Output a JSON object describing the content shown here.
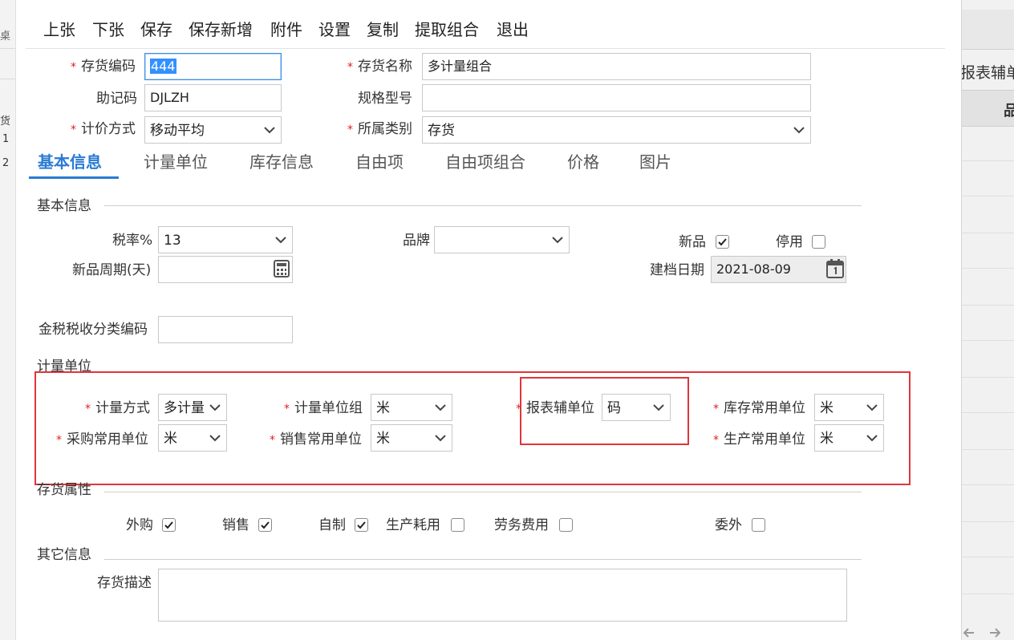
{
  "toolbar": {
    "prev": "上张",
    "next": "下张",
    "save": "保存",
    "save_new": "保存新增",
    "attach": "附件",
    "settings": "设置",
    "copy": "复制",
    "extract": "提取组合",
    "exit": "退出"
  },
  "header": {
    "code_label": "存货编码",
    "code_value": "444",
    "name_label": "存货名称",
    "name_value": "多计量组合",
    "mnemonic_label": "助记码",
    "mnemonic_value": "DJLZH",
    "spec_label": "规格型号",
    "spec_value": "",
    "pricing_label": "计价方式",
    "pricing_value": "移动平均",
    "category_label": "所属类别",
    "category_value": "存货"
  },
  "tabs": [
    "基本信息",
    "计量单位",
    "库存信息",
    "自由项",
    "自由项组合",
    "价格",
    "图片"
  ],
  "basic": {
    "section": "基本信息",
    "tax_label": "税率%",
    "tax_value": "13",
    "brand_label": "品牌",
    "brand_value": "",
    "new_label": "新品",
    "new_checked": true,
    "disabled_label": "停用",
    "disabled_checked": false,
    "new_period_label": "新品周期(天)",
    "new_period_value": "",
    "created_label": "建档日期",
    "created_value": "2021-08-09",
    "tax_class_label": "金税税收分类编码",
    "tax_class_value": ""
  },
  "units": {
    "section": "计量单位",
    "method_label": "计量方式",
    "method_value": "多计量",
    "group_label": "计量单位组",
    "group_value": "米",
    "report_label": "报表辅单位",
    "report_value": "码",
    "stock_label": "库存常用单位",
    "stock_value": "米",
    "purchase_label": "采购常用单位",
    "purchase_value": "米",
    "sales_label": "销售常用单位",
    "sales_value": "米",
    "production_label": "生产常用单位",
    "production_value": "米"
  },
  "attributes": {
    "section": "存货属性",
    "items": [
      {
        "label": "外购",
        "checked": true
      },
      {
        "label": "销售",
        "checked": true
      },
      {
        "label": "自制",
        "checked": true
      },
      {
        "label": "生产耗用",
        "checked": false
      },
      {
        "label": "劳务费用",
        "checked": false
      },
      {
        "label": "委外",
        "checked": false
      }
    ]
  },
  "other": {
    "section": "其它信息",
    "desc_label": "存货描述",
    "desc_value": ""
  },
  "background": {
    "left_chars": [
      "桌",
      "货",
      "1",
      "2"
    ],
    "right_title": "报表辅单位存",
    "right_col": "品"
  },
  "colors": {
    "accent": "#2a7bd4",
    "required": "#e02020",
    "highlight_box": "#e0353b"
  }
}
